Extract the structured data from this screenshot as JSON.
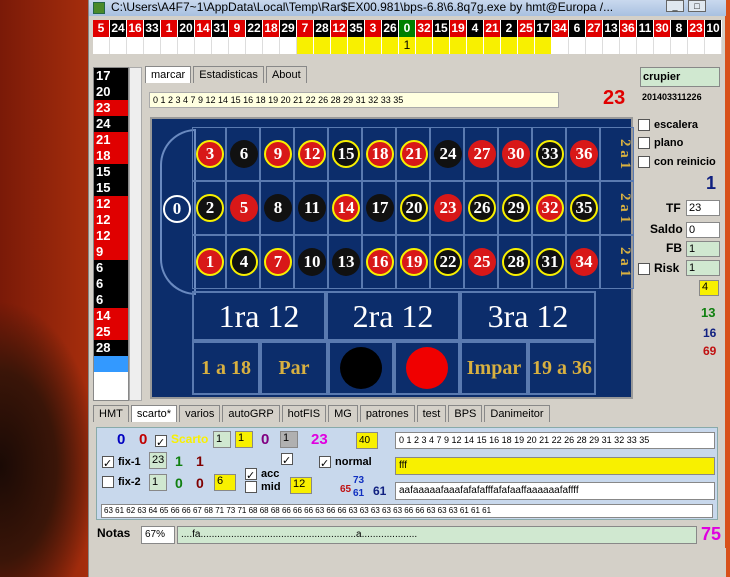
{
  "window": {
    "title": "C:\\Users\\A4F7~1\\AppData\\Local\\Temp\\Rar$EX00.981\\bps-6.8\\6.8q7g.exe   by hmt@Europa /..."
  },
  "history_top": [
    {
      "n": "5",
      "c": "#e00000"
    },
    {
      "n": "24",
      "c": "#000000"
    },
    {
      "n": "16",
      "c": "#e00000"
    },
    {
      "n": "33",
      "c": "#000000"
    },
    {
      "n": "1",
      "c": "#e00000"
    },
    {
      "n": "20",
      "c": "#000000"
    },
    {
      "n": "14",
      "c": "#e00000"
    },
    {
      "n": "31",
      "c": "#000000"
    },
    {
      "n": "9",
      "c": "#e00000"
    },
    {
      "n": "22",
      "c": "#000000"
    },
    {
      "n": "18",
      "c": "#e00000"
    },
    {
      "n": "29",
      "c": "#000000"
    },
    {
      "n": "7",
      "c": "#e00000"
    },
    {
      "n": "28",
      "c": "#000000"
    },
    {
      "n": "12",
      "c": "#e00000"
    },
    {
      "n": "35",
      "c": "#000000"
    },
    {
      "n": "3",
      "c": "#e00000"
    },
    {
      "n": "26",
      "c": "#000000"
    },
    {
      "n": "0",
      "c": "#008000"
    },
    {
      "n": "32",
      "c": "#e00000"
    },
    {
      "n": "15",
      "c": "#000000"
    },
    {
      "n": "19",
      "c": "#e00000"
    },
    {
      "n": "4",
      "c": "#000000"
    },
    {
      "n": "21",
      "c": "#e00000"
    },
    {
      "n": "2",
      "c": "#000000"
    },
    {
      "n": "25",
      "c": "#e00000"
    },
    {
      "n": "17",
      "c": "#000000"
    },
    {
      "n": "34",
      "c": "#e00000"
    },
    {
      "n": "6",
      "c": "#000000"
    },
    {
      "n": "27",
      "c": "#e00000"
    },
    {
      "n": "13",
      "c": "#000000"
    },
    {
      "n": "36",
      "c": "#e00000"
    },
    {
      "n": "11",
      "c": "#000000"
    },
    {
      "n": "30",
      "c": "#e00000"
    },
    {
      "n": "8",
      "c": "#000000"
    },
    {
      "n": "23",
      "c": "#e00000"
    },
    {
      "n": "10",
      "c": "#000000"
    }
  ],
  "history_marker": "1",
  "left_list": [
    {
      "n": "17",
      "c": "#000000"
    },
    {
      "n": "20",
      "c": "#000000"
    },
    {
      "n": "23",
      "c": "#e00000"
    },
    {
      "n": "24",
      "c": "#000000"
    },
    {
      "n": "21",
      "c": "#e00000"
    },
    {
      "n": "18",
      "c": "#e00000"
    },
    {
      "n": "15",
      "c": "#000000"
    },
    {
      "n": "15",
      "c": "#000000"
    },
    {
      "n": "12",
      "c": "#e00000"
    },
    {
      "n": "12",
      "c": "#e00000"
    },
    {
      "n": "12",
      "c": "#e00000"
    },
    {
      "n": "9",
      "c": "#e00000"
    },
    {
      "n": "6",
      "c": "#000000"
    },
    {
      "n": "6",
      "c": "#000000"
    },
    {
      "n": "6",
      "c": "#000000"
    },
    {
      "n": "14",
      "c": "#e00000"
    },
    {
      "n": "25",
      "c": "#e00000"
    },
    {
      "n": "28",
      "c": "#000000"
    }
  ],
  "top_tabs": {
    "marcar": "marcar",
    "estadisticas": "Estadisticas",
    "about": "About"
  },
  "number_sequence": "0 1 2 3 4 7 9 12 14 15 16 18 19 20 21 22 26 28 29 31 32 33 35",
  "last_number": "23",
  "table": {
    "zero": "0",
    "rows": [
      [
        {
          "n": "3",
          "c": "r",
          "ring": true
        },
        {
          "n": "6",
          "c": "b",
          "ring": false
        },
        {
          "n": "9",
          "c": "r",
          "ring": true
        },
        {
          "n": "12",
          "c": "r",
          "ring": true
        },
        {
          "n": "15",
          "c": "b",
          "ring": true
        },
        {
          "n": "18",
          "c": "r",
          "ring": true
        },
        {
          "n": "21",
          "c": "r",
          "ring": true
        },
        {
          "n": "24",
          "c": "b",
          "ring": false
        },
        {
          "n": "27",
          "c": "r",
          "ring": false
        },
        {
          "n": "30",
          "c": "r",
          "ring": false
        },
        {
          "n": "33",
          "c": "b",
          "ring": true
        },
        {
          "n": "36",
          "c": "r",
          "ring": false
        }
      ],
      [
        {
          "n": "2",
          "c": "b",
          "ring": true
        },
        {
          "n": "5",
          "c": "r",
          "ring": false
        },
        {
          "n": "8",
          "c": "b",
          "ring": false
        },
        {
          "n": "11",
          "c": "b",
          "ring": false
        },
        {
          "n": "14",
          "c": "r",
          "ring": true
        },
        {
          "n": "17",
          "c": "b",
          "ring": false
        },
        {
          "n": "20",
          "c": "b",
          "ring": true
        },
        {
          "n": "23",
          "c": "r",
          "ring": false
        },
        {
          "n": "26",
          "c": "b",
          "ring": true
        },
        {
          "n": "29",
          "c": "b",
          "ring": true
        },
        {
          "n": "32",
          "c": "r",
          "ring": true
        },
        {
          "n": "35",
          "c": "b",
          "ring": true
        }
      ],
      [
        {
          "n": "1",
          "c": "r",
          "ring": true
        },
        {
          "n": "4",
          "c": "b",
          "ring": true
        },
        {
          "n": "7",
          "c": "r",
          "ring": true
        },
        {
          "n": "10",
          "c": "b",
          "ring": false
        },
        {
          "n": "13",
          "c": "b",
          "ring": false
        },
        {
          "n": "16",
          "c": "r",
          "ring": true
        },
        {
          "n": "19",
          "c": "r",
          "ring": true
        },
        {
          "n": "22",
          "c": "b",
          "ring": true
        },
        {
          "n": "25",
          "c": "r",
          "ring": false
        },
        {
          "n": "28",
          "c": "b",
          "ring": true
        },
        {
          "n": "31",
          "c": "b",
          "ring": true
        },
        {
          "n": "34",
          "c": "r",
          "ring": false
        }
      ]
    ],
    "columns": [
      "2 a 1",
      "2 a 1",
      "2 a 1"
    ],
    "dozens": [
      "1ra 12",
      "2ra 12",
      "3ra 12"
    ],
    "bottom": {
      "low": "1 a 18",
      "even": "Par",
      "odd": "Impar",
      "high": "19 a 36"
    }
  },
  "right": {
    "crupier": "crupier",
    "date": "201403311226",
    "escalera": "escalera",
    "plano": "plano",
    "con_reinicio": "con reinicio",
    "count": "1",
    "tf_label": "TF",
    "tf_value": "23",
    "saldo_label": "Saldo",
    "saldo_value": "0",
    "fb_label": "FB",
    "fb_value": "1",
    "risk_label": "Risk",
    "risk_value": "1",
    "yellow_value": "4",
    "n13": "13",
    "n16": "16",
    "n69": "69"
  },
  "bottom_tabs": [
    "HMT",
    "scarto*",
    "varios",
    "autoGRP",
    "hotFIS",
    "MG",
    "patrones",
    "test",
    "BPS",
    "Danimeitor"
  ],
  "bottom": {
    "zero_a": "0",
    "zero_b": "0",
    "scarto": "Scarto",
    "box1": "1",
    "box1y": "1",
    "zero_c": "0",
    "box1g": "1",
    "n23": "23",
    "n40": "40",
    "seq": "0 1 2 3 4 7 9 12 14 15 16 18 19 20 21 22 26 28 29 31 32 33 35",
    "fix1": "fix-1",
    "fix1_box": "23",
    "fix1_a": "1",
    "fix1_b": "1",
    "normal": "normal",
    "fff": "fff",
    "fix2": "fix-2",
    "fix2_box": "1",
    "fix2_a": "0",
    "fix2_b": "0",
    "fix2_y": "6",
    "acc": "acc",
    "mid": "mid",
    "mid_box": "12",
    "n65": "65",
    "n73": "73",
    "n61a": "61",
    "n61b": "61",
    "pattern": "aafaaaaafaaafafafafffafafaaffaaaaaafaffff",
    "numbers_row": "63 61 62 63 64 65 66 66 67 68 71 73 71 68 68 68 66 66 66 63 66 66 63 63 63 63 63 66 66 63 63 63 61 61 61"
  },
  "notas": {
    "label": "Notas",
    "percent": "67%",
    "text": "....fa........................................................a....................",
    "count": "75"
  }
}
